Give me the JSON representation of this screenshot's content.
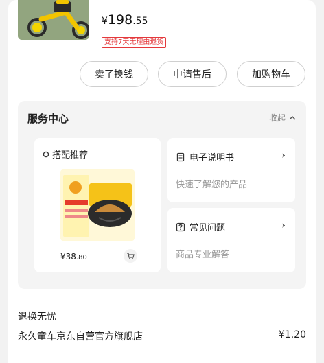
{
  "product": {
    "price_currency": "¥",
    "price_int": "198",
    "price_dec": ".55",
    "return_tag": "支持7天无理由退货"
  },
  "actions": {
    "sell": "卖了换钱",
    "after_sale": "申请售后",
    "add_cart": "加购物车"
  },
  "service": {
    "title": "服务中心",
    "collapse_label": "收起",
    "recommend_title": "搭配推荐",
    "recommend_price_int": "¥38",
    "recommend_price_dec": ".80",
    "manual_title": "电子说明书",
    "manual_sub": "快速了解您的产品",
    "faq_title": "常见问题",
    "faq_sub": "商品专业解答"
  },
  "bottom": {
    "return_label": "退换无忧",
    "store_name": "永久童车京东自营官方旗舰店",
    "store_price": "¥1.20"
  },
  "colors": {
    "accent": "#e4393c",
    "panel_bg": "#f4f4f4"
  },
  "icons": [
    "tricycle-product-image",
    "circle-icon",
    "cart-icon",
    "document-icon",
    "question-icon",
    "chevron-right-icon",
    "chevron-up-icon"
  ]
}
